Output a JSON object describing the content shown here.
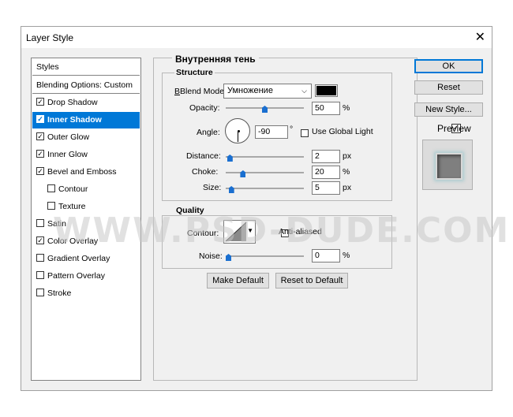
{
  "window": {
    "title": "Layer Style",
    "close": "✕"
  },
  "sidebar": {
    "items": [
      {
        "label": "Styles",
        "checkbox": false
      },
      {
        "label": "Blending Options: Custom",
        "checkbox": false
      },
      {
        "label": "Drop Shadow",
        "checkbox": true,
        "checked": true
      },
      {
        "label": "Inner Shadow",
        "checkbox": true,
        "checked": true,
        "selected": true
      },
      {
        "label": "Outer Glow",
        "checkbox": true,
        "checked": true
      },
      {
        "label": "Inner Glow",
        "checkbox": true,
        "checked": true
      },
      {
        "label": "Bevel and Emboss",
        "checkbox": true,
        "checked": true
      },
      {
        "label": "Contour",
        "checkbox": true,
        "checked": false,
        "indent": true
      },
      {
        "label": "Texture",
        "checkbox": true,
        "checked": false,
        "indent": true
      },
      {
        "label": "Satin",
        "checkbox": true,
        "checked": false
      },
      {
        "label": "Color Overlay",
        "checkbox": true,
        "checked": true
      },
      {
        "label": "Gradient Overlay",
        "checkbox": true,
        "checked": false
      },
      {
        "label": "Pattern Overlay",
        "checkbox": true,
        "checked": false
      },
      {
        "label": "Stroke",
        "checkbox": true,
        "checked": false
      }
    ]
  },
  "panel": {
    "heading": "Внутренняя тень",
    "structure": {
      "title": "Structure",
      "blend_mode_label": "Blend Mode:",
      "blend_mode_value": "Умножение",
      "blend_color": "#000000",
      "opacity_label": "Opacity:",
      "opacity_value": "50",
      "opacity_unit": "%",
      "opacity_level": 0.5,
      "angle_label": "Angle:",
      "angle_value": "-90",
      "angle_unit": "°",
      "use_global_light_label": "Use Global Light",
      "use_global_light": false,
      "distance_label": "Distance:",
      "distance_value": "2",
      "distance_unit": "px",
      "distance_level": 0.02,
      "choke_label": "Choke:",
      "choke_value": "20",
      "choke_unit": "%",
      "choke_level": 0.2,
      "size_label": "Size:",
      "size_value": "5",
      "size_unit": "px",
      "size_level": 0.04
    },
    "quality": {
      "title": "Quality",
      "contour_label": "Contour:",
      "anti_aliased_label": "Anti-aliased",
      "anti_aliased": false,
      "noise_label": "Noise:",
      "noise_value": "0",
      "noise_unit": "%",
      "noise_level": 0.0
    },
    "make_default": "Make Default",
    "reset_to_default": "Reset to Default"
  },
  "buttons": {
    "ok": "OK",
    "reset": "Reset",
    "new_style": "New Style...",
    "preview_label": "Preview",
    "preview_checked": true
  },
  "watermark": "WWW.PSD-DUDE.COM",
  "colors": {
    "accent": "#0078d7",
    "slider_thumb": "#1a6fd0"
  }
}
